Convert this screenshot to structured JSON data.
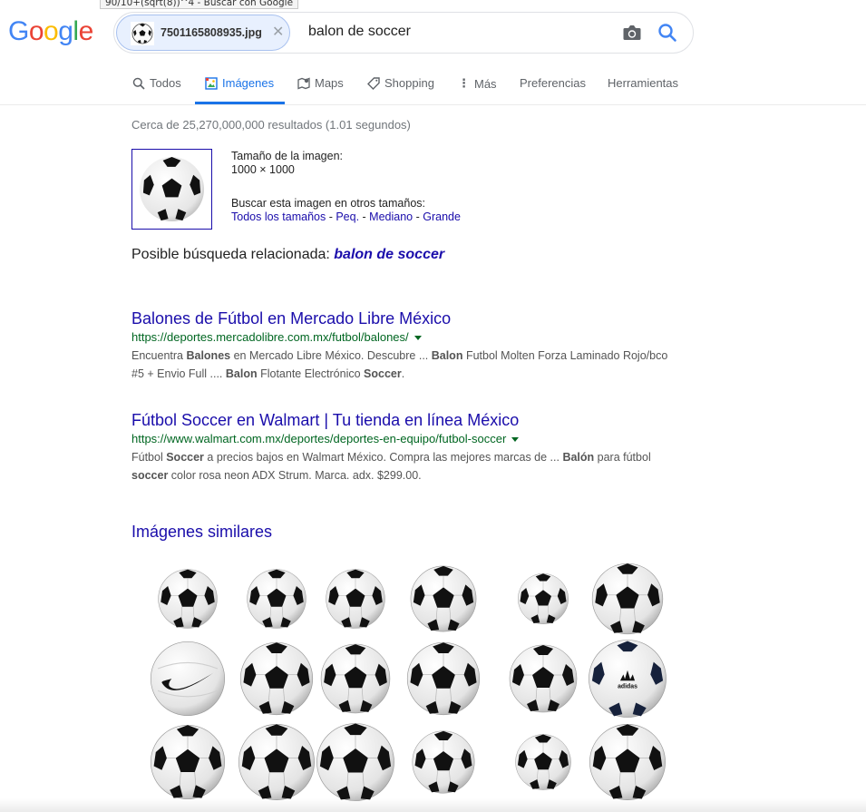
{
  "browser": {
    "tooltip": "90/10+(sqrt(8))^4 - Buscar con Google"
  },
  "logo": {
    "text": "Google",
    "colors": [
      "#4285F4",
      "#EA4335",
      "#FBBC05",
      "#4285F4",
      "#34A853",
      "#EA4335"
    ]
  },
  "search": {
    "image_chip": {
      "filename": "7501165808935.jpg",
      "close_icon": "close-icon"
    },
    "query": "balon de soccer",
    "camera_icon": "camera-icon",
    "search_icon": "search-icon"
  },
  "tabs": [
    {
      "label": "Todos",
      "icon": "search-icon",
      "active": false
    },
    {
      "label": "Imágenes",
      "icon": "image-icon",
      "active": true
    },
    {
      "label": "Maps",
      "icon": "map-icon",
      "active": false
    },
    {
      "label": "Shopping",
      "icon": "tag-icon",
      "active": false
    },
    {
      "label": "Más",
      "icon": "more-vert-icon",
      "active": false
    },
    {
      "label": "Preferencias",
      "icon": "",
      "active": false
    },
    {
      "label": "Herramientas",
      "icon": "",
      "active": false
    }
  ],
  "stats": "Cerca de 25,270,000,000 resultados (1.01 segundos)",
  "query_image": {
    "size_label": "Tamaño de la imagen:",
    "size_value": "1000 × 1000",
    "other_sizes_label": "Buscar esta imagen en otros tamaños:",
    "size_links": [
      "Todos los tamaños",
      "Peq.",
      "Mediano",
      "Grande"
    ],
    "separator": " - "
  },
  "related": {
    "label": "Posible búsqueda relacionada: ",
    "query": "balon de soccer"
  },
  "results": [
    {
      "title": "Balones de Fútbol en Mercado Libre México",
      "url": "https://deportes.mercadolibre.com.mx/futbol/balones/",
      "snippet_html": "Encuentra <b>Balones</b> en Mercado Libre México. Descubre ... <b>Balon</b> Futbol Molten Forza Laminado Rojo/bco #5 + Envio Full .... <b>Balon</b> Flotante Electrónico <b>Soccer</b>."
    },
    {
      "title": "Fútbol Soccer en Walmart | Tu tienda en línea México",
      "url": "https://www.walmart.com.mx/deportes/deportes-en-equipo/futbol-soccer",
      "snippet_html": "Fútbol <b>Soccer</b> a precios bajos en Walmart México. Compra las mejores marcas de ... <b>Balón</b> para fútbol <b>soccer</b> color rosa neon ADX Strum. Marca. adx. $299.00."
    }
  ],
  "similar": {
    "title": "Imágenes similares",
    "images": [
      {
        "style": "classic"
      },
      {
        "style": "classic"
      },
      {
        "style": "classic"
      },
      {
        "style": "classic"
      },
      {
        "style": "classic"
      },
      {
        "style": "classic"
      },
      {
        "style": "nike"
      },
      {
        "style": "classic"
      },
      {
        "style": "classic"
      },
      {
        "style": "classic"
      },
      {
        "style": "classic"
      },
      {
        "style": "adidas"
      },
      {
        "style": "classic"
      },
      {
        "style": "classic"
      },
      {
        "style": "classic"
      },
      {
        "style": "classic"
      },
      {
        "style": "classic"
      },
      {
        "style": "classic"
      }
    ],
    "brand_nike": "",
    "brand_adidas": "adidas"
  },
  "colors": {
    "link": "#1a0dab",
    "url_green": "#006621",
    "accent_blue": "#1a73e8",
    "chip_bg": "#e8f0fe"
  }
}
